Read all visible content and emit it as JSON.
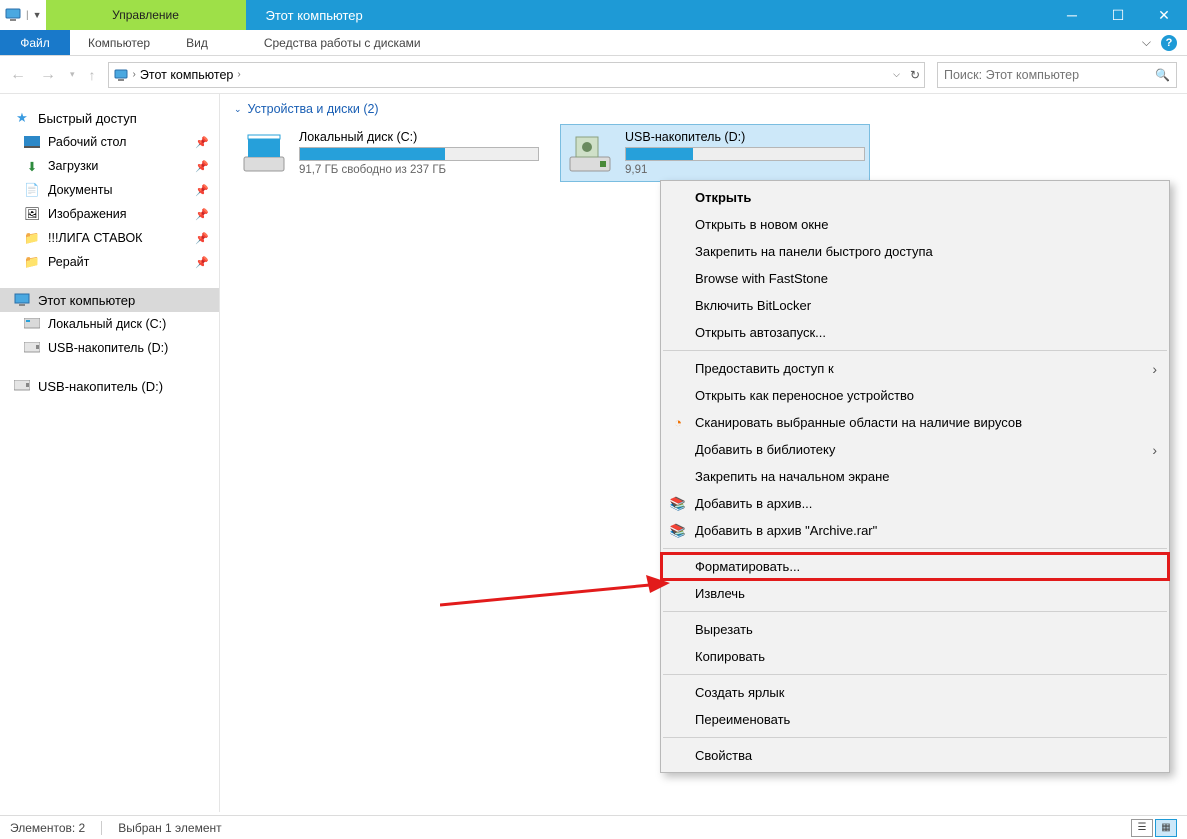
{
  "titlebar": {
    "manage_tab": "Управление",
    "window_title": "Этот компьютер"
  },
  "ribbon": {
    "file": "Файл",
    "computer": "Компьютер",
    "view": "Вид",
    "drive_tools": "Средства работы с дисками"
  },
  "addressbar": {
    "root_crumb": "Этот компьютер",
    "search_placeholder": "Поиск: Этот компьютер"
  },
  "sidebar": {
    "quick_access": "Быстрый доступ",
    "desktop": "Рабочий стол",
    "downloads": "Загрузки",
    "documents": "Документы",
    "pictures": "Изображения",
    "liga": "!!!ЛИГА СТАВОК",
    "rewrite": "Рерайт",
    "this_pc": "Этот компьютер",
    "local_c": "Локальный диск (C:)",
    "usb_d": "USB-накопитель (D:)",
    "usb_d2": "USB-накопитель (D:)"
  },
  "content": {
    "group_header": "Устройства и диски (2)",
    "drive_c": {
      "name": "Локальный диск (C:)",
      "subtext": "91,7 ГБ свободно из 237 ГБ",
      "fill_pct": 61
    },
    "drive_d": {
      "name": "USB-накопитель (D:)",
      "subtext": "9,91",
      "fill_pct": 28
    }
  },
  "context_menu": {
    "open": "Открыть",
    "open_new_window": "Открыть в новом окне",
    "pin_quick": "Закрепить на панели быстрого доступа",
    "faststone": "Browse with FastStone",
    "bitlocker": "Включить BitLocker",
    "autoplay": "Открыть автозапуск...",
    "give_access": "Предоставить доступ к",
    "portable": "Открыть как переносное устройство",
    "scan": "Сканировать выбранные области на наличие вирусов",
    "library": "Добавить в библиотеку",
    "pin_start": "Закрепить на начальном экране",
    "archive": "Добавить в архив...",
    "archive_rar": "Добавить в архив \"Archive.rar\"",
    "format": "Форматировать...",
    "eject": "Извлечь",
    "cut": "Вырезать",
    "copy": "Копировать",
    "shortcut": "Создать ярлык",
    "rename": "Переименовать",
    "properties": "Свойства"
  },
  "statusbar": {
    "count": "Элементов: 2",
    "selected": "Выбран 1 элемент"
  }
}
